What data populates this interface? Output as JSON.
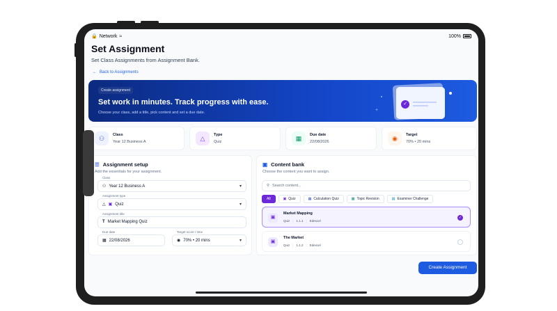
{
  "status_bar": {
    "network": "Network",
    "battery": "100%"
  },
  "page": {
    "title": "Set Assignment",
    "subtitle": "Set Class Assignments from Assignment Bank.",
    "back_label": "Back to Assignments"
  },
  "hero": {
    "chip": "Create assignment",
    "heading": "Set work in minutes. Track progress with ease.",
    "text": "Choose your class, add a title, pick content and set a due date."
  },
  "summary": [
    {
      "key": "Class",
      "value": "Year 12 Business A",
      "icon": "users-icon",
      "color": "#eef2ff"
    },
    {
      "key": "Type",
      "value": "Quiz",
      "icon": "shapes-icon",
      "color": "#f3e8ff"
    },
    {
      "key": "Due date",
      "value": "22/08/2026",
      "icon": "calendar-icon",
      "color": "#ecfdf5"
    },
    {
      "key": "Target",
      "value": "70% • 20 mins",
      "icon": "target-icon",
      "color": "#fff7ed"
    }
  ],
  "setup": {
    "title": "Assignment setup",
    "subtitle": "Add the essentials for your assignment.",
    "class_label": "Class",
    "class_value": "Year 12 Business A",
    "type_label": "Assignment type",
    "type_value": "Quiz",
    "title_label": "Assignment title",
    "title_value": "Market Mapping Quiz",
    "due_label": "Due date",
    "due_value": "22/08/2026",
    "target_label": "Target score / time",
    "target_value": "70% • 20 mins"
  },
  "bank": {
    "title": "Content bank",
    "subtitle": "Choose the content you want to assign.",
    "search_placeholder": "Search content...",
    "filters": [
      "All",
      "Quiz",
      "Calculation Quiz",
      "Topic Revision",
      "Examiner Challenge"
    ],
    "items": [
      {
        "title": "Market Mapping",
        "type": "Quiz",
        "code": "1.1.1",
        "board": "Edexcel",
        "selected": true
      },
      {
        "title": "The Market",
        "type": "Quiz",
        "code": "1.1.2",
        "board": "Edexcel",
        "selected": false
      }
    ]
  },
  "create_button": "Create Assignment"
}
